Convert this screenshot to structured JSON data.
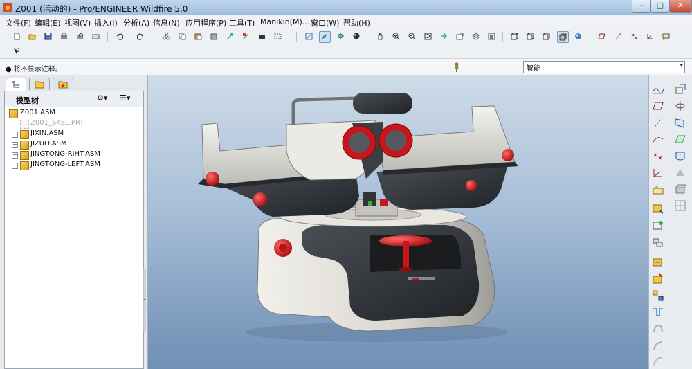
{
  "window": {
    "title": "Z001 (活动的) - Pro/ENGINEER Wildfire 5.0",
    "minimize_glyph": "–",
    "maximize_glyph": "□",
    "close_glyph": "✕"
  },
  "menu": [
    {
      "label": "文件(F)"
    },
    {
      "label": "编辑(E)"
    },
    {
      "label": "视图(V)"
    },
    {
      "label": "插入(I)"
    },
    {
      "label": "分析(A)"
    },
    {
      "label": "信息(N)"
    },
    {
      "label": "应用程序(P)"
    },
    {
      "label": "工具(T)"
    },
    {
      "label": "Manikin(M)..."
    },
    {
      "label": "窗口(W)"
    },
    {
      "label": "帮助(H)"
    }
  ],
  "toolbar_icons": [
    "new-file-icon",
    "open-file-icon",
    "save-icon",
    "print-icon",
    "print-preview-icon",
    "email-icon",
    "undo-icon",
    "redo-icon",
    "cut-icon",
    "copy-icon",
    "paste-icon",
    "paste-special-icon",
    "regenerate-icon",
    "regen-manager-icon",
    "find-icon",
    "selection-box-icon",
    "redraw-icon",
    "spin-center-icon",
    "orient-icon",
    "appearance-icon",
    "pan-icon",
    "zoom-in-icon",
    "zoom-out-icon",
    "refit-icon",
    "reorient-icon",
    "saved-views-icon",
    "layers-icon",
    "view-manager-icon",
    "wireframe-icon",
    "hidden-line-icon",
    "no-hidden-icon",
    "shading-icon",
    "realtime-render-icon",
    "datum-planes-icon",
    "datum-axes-icon",
    "datum-points-icon",
    "coordinate-systems-icon"
  ],
  "colors": {
    "accent": "#3f7fd0",
    "model_red": "#c8141a",
    "model_dark": "#2f3236",
    "model_light": "#d8d6cf"
  },
  "status": {
    "message": "● 将不显示注释。",
    "filter_value": "智能",
    "filter_arrow": "▾"
  },
  "navigator": {
    "tree_title": "模型树",
    "settings_glyph": "⚙▾",
    "show_glyph": "☰▾",
    "tree": [
      {
        "label": "Z001.ASM",
        "kind": "asm",
        "level": 0,
        "expander": ""
      },
      {
        "label": "Z001_SKEL.PRT",
        "kind": "skel",
        "level": 1,
        "expander": ""
      },
      {
        "label": "JIXIN.ASM",
        "kind": "asm",
        "level": 1,
        "expander": "+"
      },
      {
        "label": "JIZUO.ASM",
        "kind": "asm",
        "level": 1,
        "expander": "+"
      },
      {
        "label": "JINGTONG-RIHT.ASM",
        "kind": "asm",
        "level": 1,
        "expander": "+"
      },
      {
        "label": "JINGTONG-LEFT.ASM",
        "kind": "asm",
        "level": 1,
        "expander": "+"
      }
    ]
  },
  "right_toolbar_icons": [
    "sketch-datum-curve-icon",
    "datum-plane-tool-icon",
    "datum-axis-tool-icon",
    "datum-curve-tool-icon",
    "datum-point-tool-icon",
    "datum-csys-tool-icon",
    "analysis-feature-icon",
    "assemble-component-icon",
    "create-component-icon",
    "component-interface-icon",
    "mirror-component-icon",
    "repeat-component-icon",
    "pattern-icon",
    "hole-icon",
    "shell-icon",
    "draft-icon",
    "round-icon",
    "chamfer-icon",
    "rib-icon",
    "extrude-icon",
    "revolve-icon",
    "sweep-icon",
    "blend-icon",
    "boundary-blend-icon",
    "style-icon"
  ]
}
